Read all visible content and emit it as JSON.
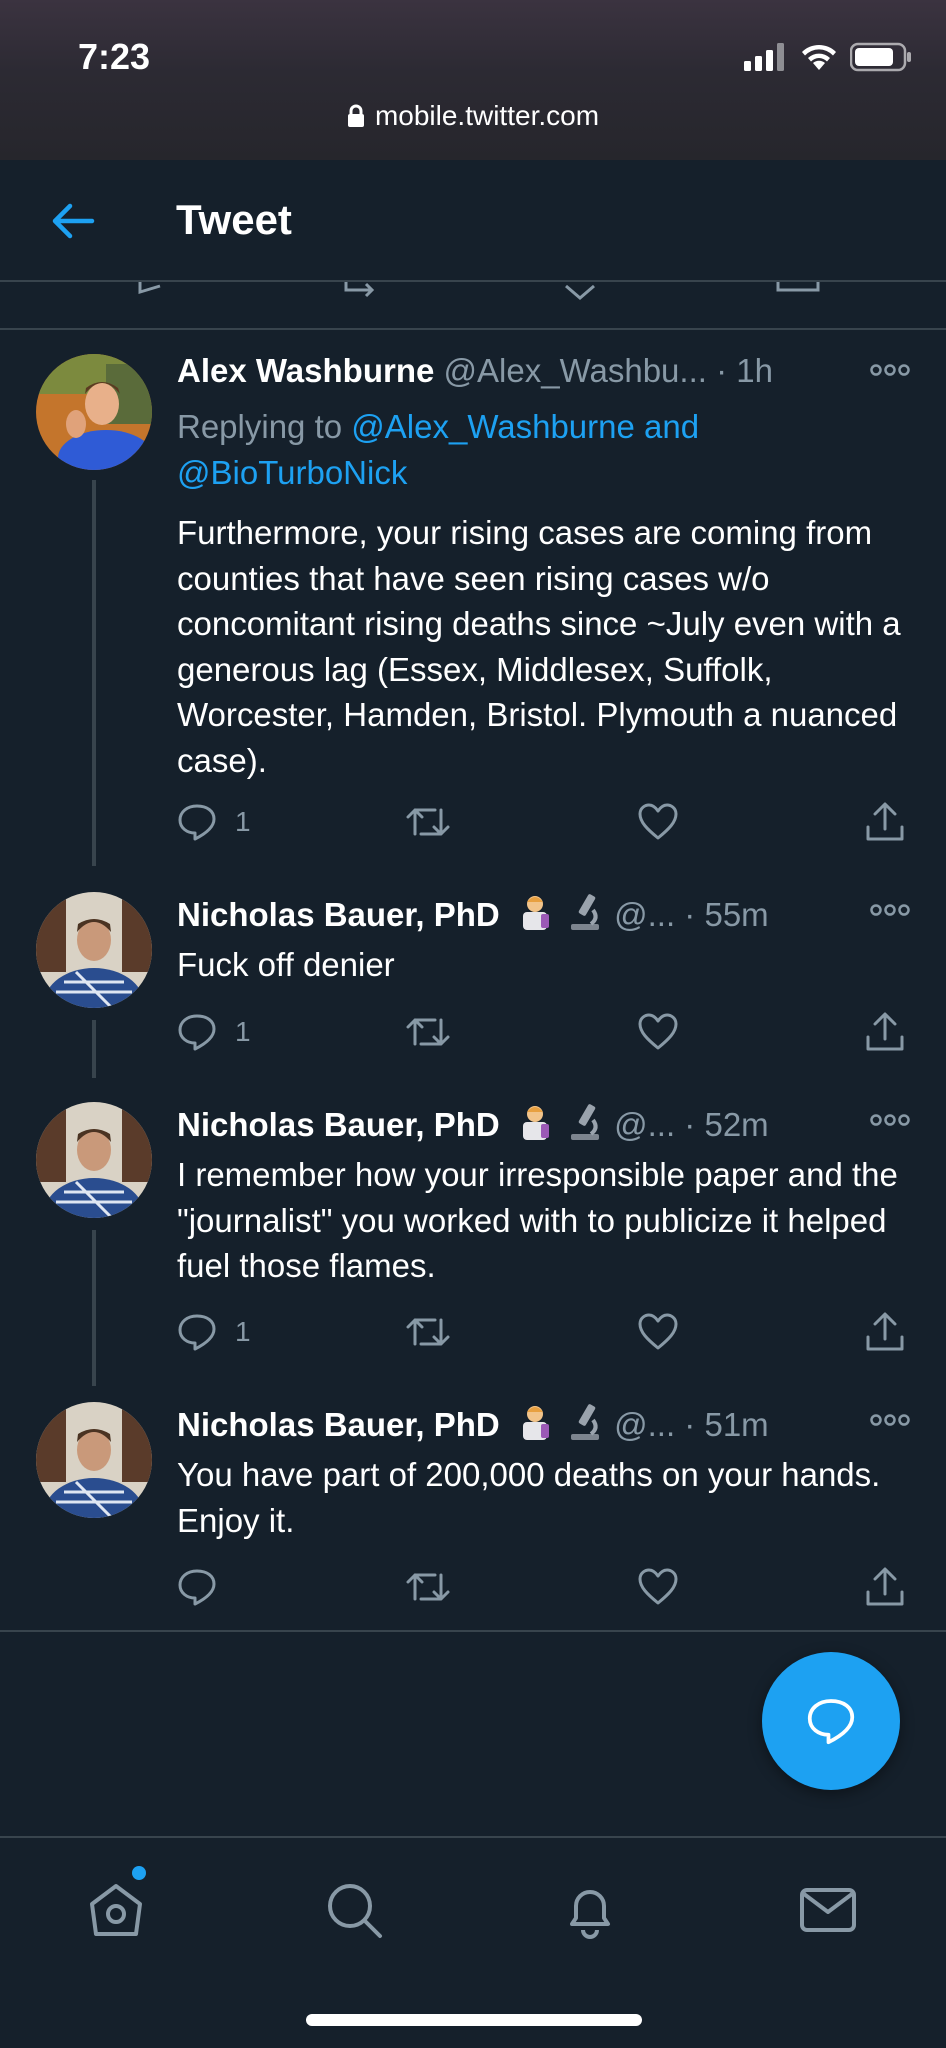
{
  "status_bar": {
    "time": "7:23"
  },
  "browser": {
    "url": "mobile.twitter.com"
  },
  "header": {
    "title": "Tweet"
  },
  "tweets": [
    {
      "name": "Alex Washburne",
      "handle": "@Alex_Washbu...",
      "dot": "·",
      "time": "1h",
      "replying_prefix": "Replying to ",
      "replying_to": "@Alex_Washburne and @BioTurboNick",
      "text": "Furthermore, your rising cases are coming from counties that have seen rising cases w/o concomitant rising deaths since ~July even with a generous lag (Essex, Middlesex, Suffolk, Worcester, Hamden, Bristol. Plymouth a nuanced case).",
      "reply_count": "1"
    },
    {
      "name": "Nicholas Bauer, PhD",
      "handle": "@...",
      "dot": "·",
      "time": "55m",
      "text": "Fuck off denier",
      "reply_count": "1"
    },
    {
      "name": "Nicholas Bauer, PhD",
      "handle": "@...",
      "dot": "·",
      "time": "52m",
      "text": "I remember how your irresponsible paper and the \"journalist\" you worked with to publicize it helped fuel those flames.",
      "reply_count": "1"
    },
    {
      "name": "Nicholas Bauer, PhD",
      "handle": "@...",
      "dot": "·",
      "time": "51m",
      "text": "You have part of 200,000 deaths on your hands. Enjoy it.",
      "reply_count": ""
    }
  ],
  "colors": {
    "background": "#15202b",
    "accent": "#1da1f2",
    "muted": "#8899a6",
    "border": "#38444d"
  },
  "nav": {
    "items": [
      "home-icon",
      "search-icon",
      "notifications-icon",
      "messages-icon"
    ]
  }
}
